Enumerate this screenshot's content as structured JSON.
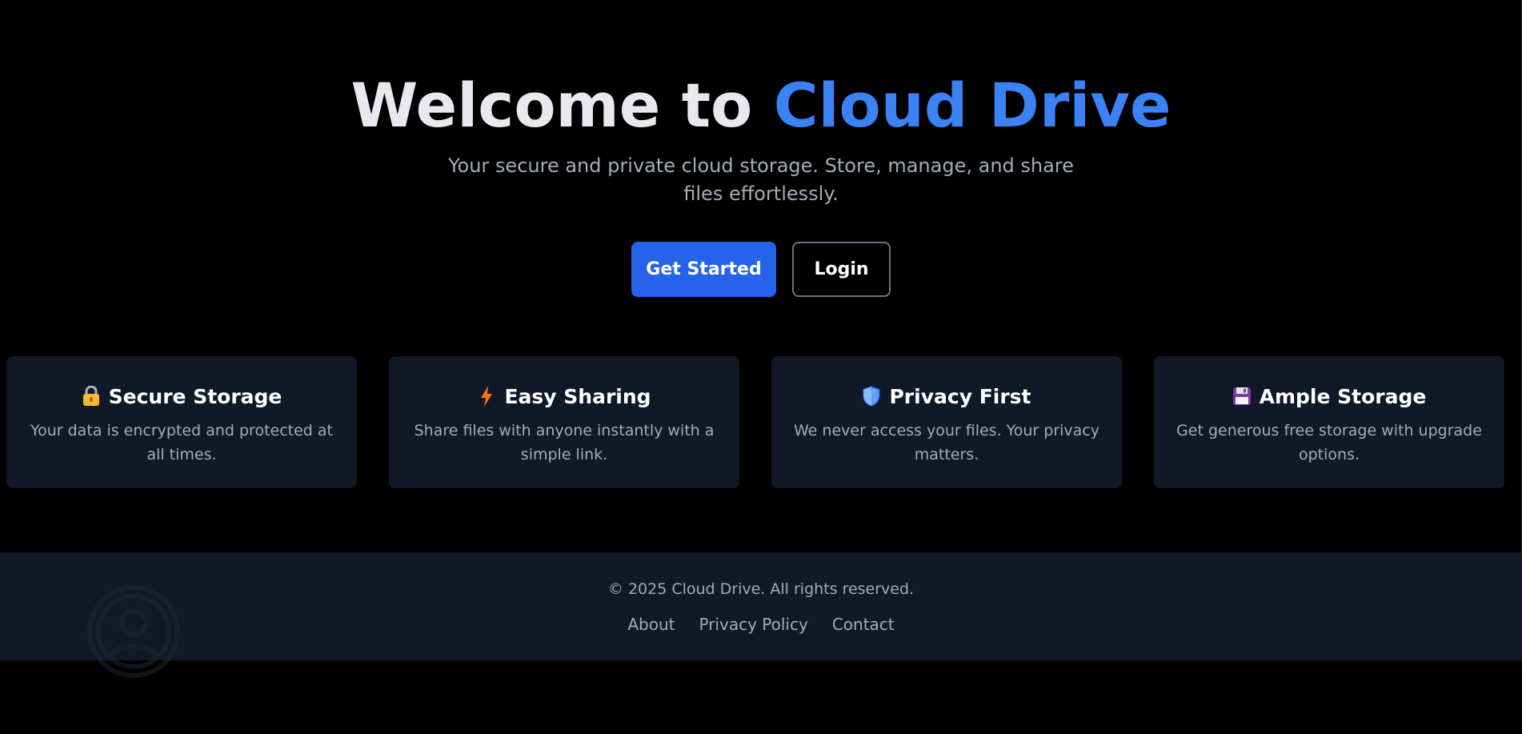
{
  "hero": {
    "title_prefix": "Welcome to ",
    "title_brand": "Cloud Drive",
    "subtitle": "Your secure and private cloud storage. Store, manage, and share files effortlessly.",
    "primary_button": "Get Started",
    "secondary_button": "Login"
  },
  "features": [
    {
      "icon": "lock-icon",
      "title": "Secure Storage",
      "description": "Your data is encrypted and protected at all times."
    },
    {
      "icon": "lightning-icon",
      "title": "Easy Sharing",
      "description": "Share files with anyone instantly with a simple link."
    },
    {
      "icon": "shield-icon",
      "title": "Privacy First",
      "description": "We never access your files. Your privacy matters."
    },
    {
      "icon": "floppy-disk-icon",
      "title": "Ample Storage",
      "description": "Get generous free storage with upgrade options."
    }
  ],
  "footer": {
    "copyright": "© 2025 Cloud Drive. All rights reserved.",
    "links": [
      "About",
      "Privacy Policy",
      "Contact"
    ]
  },
  "colors": {
    "background": "#000000",
    "accent": "#3b82f6",
    "primary_button": "#2563eb",
    "card_background": "#111827",
    "muted_text": "#a4acb9"
  }
}
